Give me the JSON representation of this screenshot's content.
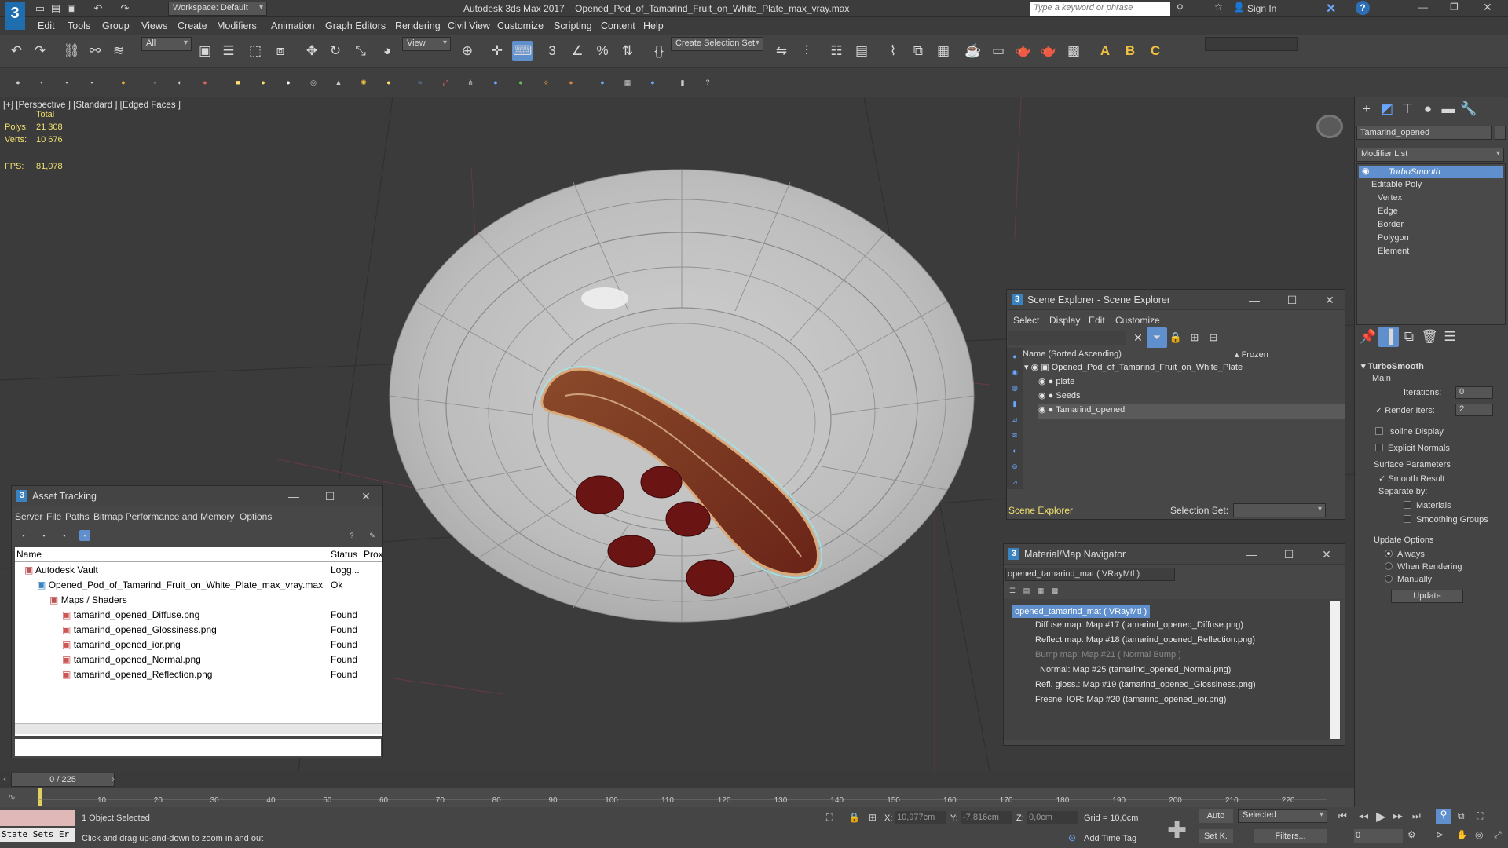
{
  "app": {
    "title": "Autodesk 3ds Max 2017",
    "file": "Opened_Pod_of_Tamarind_Fruit_on_White_Plate_max_vray.max",
    "workspace": "Workspace: Default",
    "search_placeholder": "Type a keyword or phrase",
    "sign_in": "Sign In"
  },
  "menu": [
    "Edit",
    "Tools",
    "Group",
    "Views",
    "Create",
    "Modifiers",
    "Animation",
    "Graph Editors",
    "Rendering",
    "Civil View",
    "Customize",
    "Scripting",
    "Content",
    "Help"
  ],
  "toolbar": {
    "filter": "All",
    "refcoord": "View",
    "selset": "Create Selection Set",
    "percent_icon": "%"
  },
  "viewport": {
    "label": "[+] [Perspective ] [Standard ] [Edged Faces ]",
    "stats_title": "Total",
    "polys_label": "Polys:",
    "polys": "21 308",
    "verts_label": "Verts:",
    "verts": "10 676",
    "fps_label": "FPS:",
    "fps": "81,078"
  },
  "cmd": {
    "object_name": "Tamarind_opened",
    "modifier_list": "Modifier List",
    "stack": [
      "TurboSmooth",
      "Editable Poly",
      "Vertex",
      "Edge",
      "Border",
      "Polygon",
      "Element"
    ],
    "rollout": "TurboSmooth",
    "main": "Main",
    "iterations_label": "Iterations:",
    "iterations": "0",
    "render_iters_label": "Render Iters:",
    "render_iters": "2",
    "isoline": "Isoline Display",
    "explicit": "Explicit Normals",
    "surface": "Surface Parameters",
    "smooth": "Smooth Result",
    "separate": "Separate by:",
    "materials": "Materials",
    "smoothing": "Smoothing Groups",
    "update_options": "Update Options",
    "always": "Always",
    "when_rendering": "When Rendering",
    "manually": "Manually",
    "update": "Update"
  },
  "scene_explorer": {
    "title": "Scene Explorer - Scene Explorer",
    "menu": [
      "Select",
      "Display",
      "Edit",
      "Customize"
    ],
    "col_name": "Name (Sorted Ascending)",
    "col_frozen": "▴ Frozen",
    "items": [
      "Opened_Pod_of_Tamarind_Fruit_on_White_Plate",
      "plate",
      "Seeds",
      "Tamarind_opened"
    ],
    "footer_name": "Scene Explorer",
    "selection_set": "Selection Set:"
  },
  "mat_nav": {
    "title": "Material/Map Navigator",
    "field": "opened_tamarind_mat  ( VRayMtl )",
    "items": [
      "opened_tamarind_mat  ( VRayMtl )",
      "Diffuse map: Map #17 (tamarind_opened_Diffuse.png)",
      "Reflect map: Map #18 (tamarind_opened_Reflection.png)",
      "Bump map: Map #21  ( Normal Bump )",
      "Normal: Map #25 (tamarind_opened_Normal.png)",
      "Refl. gloss.: Map #19 (tamarind_opened_Glossiness.png)",
      "Fresnel IOR: Map #20 (tamarind_opened_ior.png)"
    ]
  },
  "asset": {
    "title": "Asset Tracking",
    "menu": [
      "Server",
      "File",
      "Paths",
      "Bitmap Performance and Memory",
      "Options"
    ],
    "col_name": "Name",
    "col_status": "Status",
    "col_prox": "Prox",
    "rows": [
      {
        "name": "Autodesk Vault",
        "status": "Logg..."
      },
      {
        "name": "Opened_Pod_of_Tamarind_Fruit_on_White_Plate_max_vray.max",
        "status": "Ok"
      },
      {
        "name": "Maps / Shaders",
        "status": ""
      },
      {
        "name": "tamarind_opened_Diffuse.png",
        "status": "Found"
      },
      {
        "name": "tamarind_opened_Glossiness.png",
        "status": "Found"
      },
      {
        "name": "tamarind_opened_ior.png",
        "status": "Found"
      },
      {
        "name": "tamarind_opened_Normal.png",
        "status": "Found"
      },
      {
        "name": "tamarind_opened_Reflection.png",
        "status": "Found"
      }
    ]
  },
  "timeline": {
    "frame": "0 / 225",
    "ticks": [
      "10",
      "20",
      "30",
      "40",
      "50",
      "60",
      "70",
      "80",
      "90",
      "100",
      "110",
      "120",
      "130",
      "140",
      "150",
      "160",
      "170",
      "180",
      "190",
      "200",
      "210",
      "220"
    ]
  },
  "status": {
    "state_sets": "State Sets Er",
    "selected": "1 Object Selected",
    "prompt": "Click and drag up-and-down to zoom in and out",
    "x_label": "X:",
    "x": "10,977cm",
    "y_label": "Y:",
    "y": "-7,816cm",
    "z_label": "Z:",
    "z": "0,0cm",
    "grid": "Grid = 10,0cm",
    "auto": "Auto",
    "selected_dd": "Selected",
    "setk": "Set K.",
    "filters": "Filters...",
    "add_time_tag": "Add Time Tag",
    "frame_field": "0"
  }
}
